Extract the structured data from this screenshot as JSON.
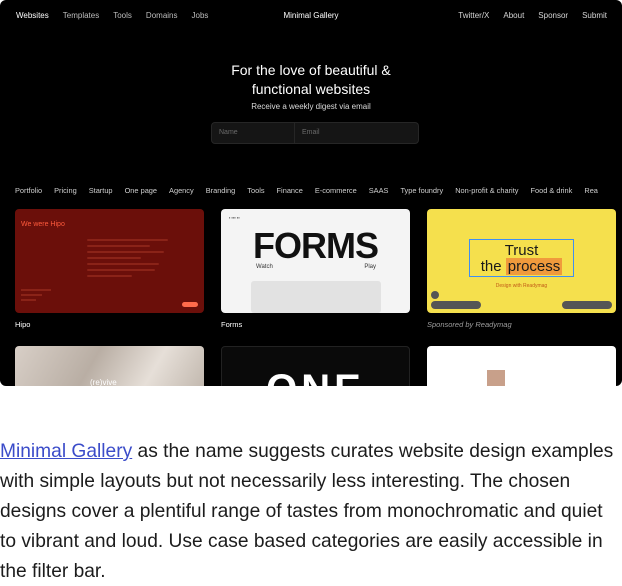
{
  "nav": {
    "left": [
      "Websites",
      "Templates",
      "Tools",
      "Domains",
      "Jobs"
    ],
    "brand": "Minimal Gallery",
    "right": [
      "Twitter/X",
      "About",
      "Sponsor",
      "Submit"
    ]
  },
  "hero": {
    "title_line1": "For the love of beautiful &",
    "title_line2": "functional websites",
    "subtitle": "Receive a weekly digest via email",
    "name_placeholder": "Name",
    "email_placeholder": "Email"
  },
  "categories": [
    "Portfolio",
    "Pricing",
    "Startup",
    "One page",
    "Agency",
    "Branding",
    "Tools",
    "Finance",
    "E-commerce",
    "SAAS",
    "Type foundry",
    "Non-profit & charity",
    "Food & drink",
    "Rea"
  ],
  "cards": {
    "hipo": {
      "label": "Hipo",
      "headline": "We were Hipo"
    },
    "forms": {
      "label": "Forms",
      "wordmark": "FORMS",
      "watch": "Watch",
      "play": "Play"
    },
    "trust": {
      "label": "Sponsored by Readymag",
      "line1": "Trust",
      "line2_a": "the",
      "line2_b": "process",
      "caption": "Design with Readymag"
    },
    "row2": {
      "a_text": "(re)vive",
      "b_text": "ONE"
    }
  },
  "article": {
    "link_text": "Minimal Gallery",
    "body": " as the name suggests curates website design examples with simple layouts but not necessarily less interesting. The chosen designs cover a plentiful range of tastes from monochromatic and quiet to vibrant and loud. Use case based categories are easily accessible in the filter bar."
  }
}
